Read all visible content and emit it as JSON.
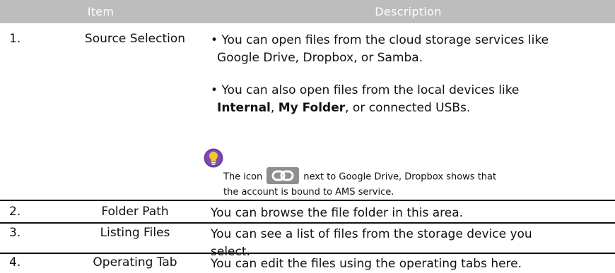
{
  "table": {
    "header": {
      "item": "Item",
      "description": "Description"
    },
    "rows": [
      {
        "number": "1.",
        "item": "Source Selection",
        "bullets": [
          {
            "lines": [
              "• You can open files from the cloud storage services like",
              "Google Drive, Dropbox, or Samba."
            ]
          },
          {
            "prefix": "• You can also open files from the local devices like",
            "bold1": "Internal",
            "sep1": ", ",
            "bold2": "My Folder",
            "tail": ", or connected USBs."
          }
        ],
        "note": {
          "icon": "lightbulb-icon",
          "text_before": "The icon",
          "link_icon": "link-icon",
          "text_after": "next to Google Drive, Dropbox shows that",
          "line2": "the account is bound to AMS service."
        }
      },
      {
        "number": "2.",
        "item": "Folder Path",
        "description": "You can browse the file folder in this area."
      },
      {
        "number": "3.",
        "item": "Listing Files",
        "description_line1": "You can see a list of files from the storage device you",
        "description_line2": "select."
      },
      {
        "number": "4.",
        "item": "Operating Tab",
        "description": "You can edit the files using the operating tabs here."
      }
    ]
  },
  "colors": {
    "header_bg": "#bdbdbd",
    "header_text": "#ffffff",
    "icon_purple": "#6d3fa0",
    "icon_yellow": "#f2c82e",
    "link_icon_bg": "#8f8f8f"
  }
}
